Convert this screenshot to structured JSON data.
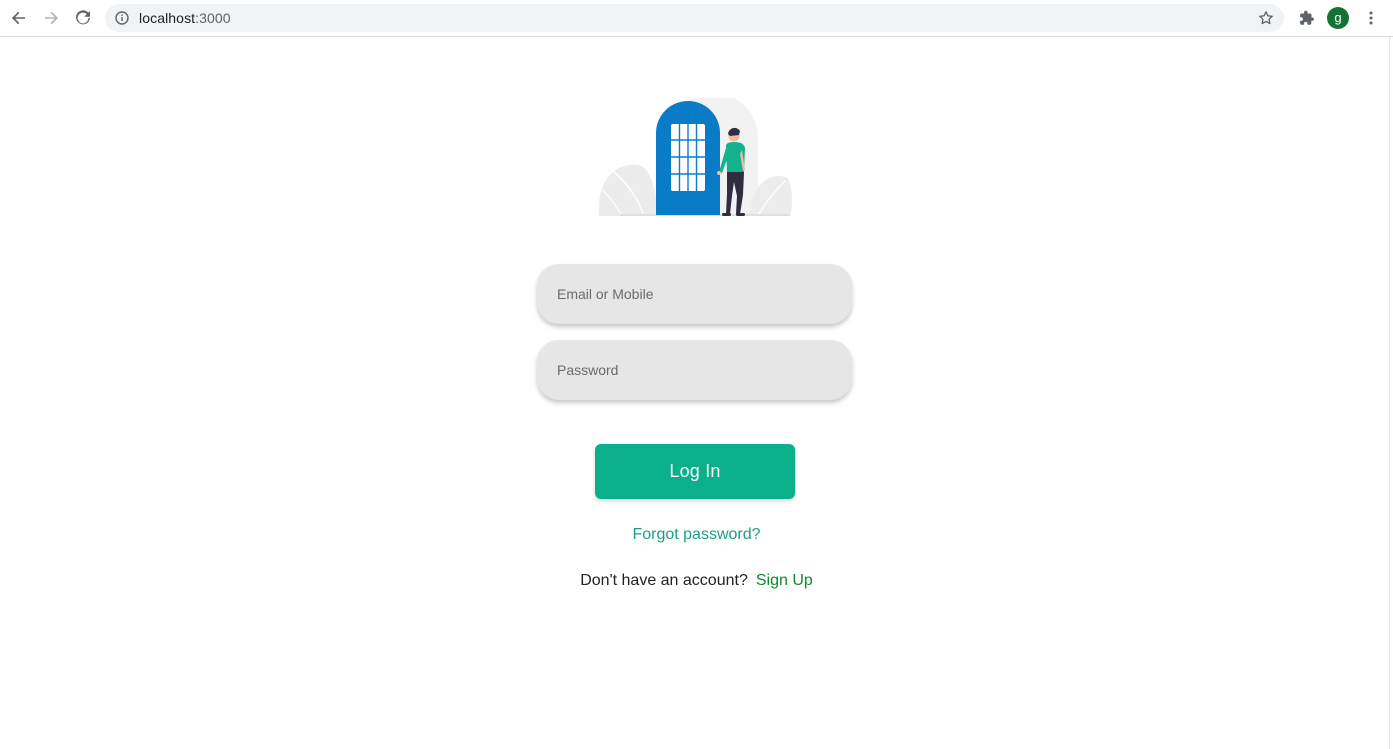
{
  "browser": {
    "url_host": "localhost",
    "url_port": ":3000",
    "profile_initial": "g",
    "colors": {
      "avatar": "#137333",
      "omnibox": "#f1f3f4"
    },
    "icons": [
      "back-arrow-icon",
      "forward-arrow-icon",
      "reload-icon",
      "info-icon",
      "bookmark-star-icon",
      "extensions-puzzle-icon",
      "more-vert-icon"
    ]
  },
  "login": {
    "email_placeholder": "Email or Mobile",
    "password_placeholder": "Password",
    "login_label": "Log In",
    "forgot_label": "Forgot password?",
    "no_account_text": "Don't have an account?",
    "signup_label": "Sign Up",
    "colors": {
      "primary": "#0ab08a",
      "forgot_link": "#1a9f86",
      "signup_link": "#0e8a2a",
      "field_bg": "#e6e6e6",
      "door": "#0a7cc7",
      "person_shirt": "#12b28c"
    }
  }
}
